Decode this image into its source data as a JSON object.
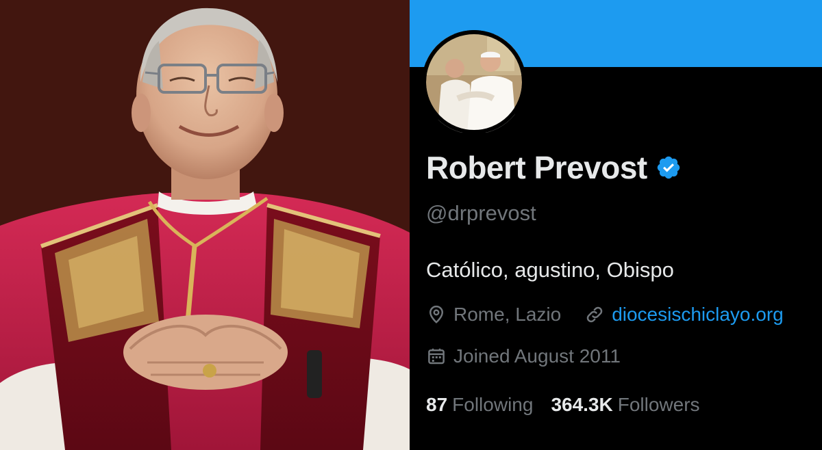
{
  "profile": {
    "name": "Robert Prevost",
    "handle": "@drprevost",
    "bio": "Católico, agustino, Obispo",
    "location": "Rome, Lazio",
    "website": "diocesischiclayo.org",
    "joined": "Joined August 2011",
    "following_count": "87",
    "following_label": "Following",
    "followers_count": "364.3K",
    "followers_label": "Followers"
  },
  "icons": {
    "verified": "verified-badge-icon",
    "location": "location-pin-icon",
    "link": "link-icon",
    "calendar": "calendar-icon"
  },
  "colors": {
    "banner": "#1d9bf0",
    "background": "#000000",
    "primary_text": "#e7e9ea",
    "secondary_text": "#71767b",
    "accent": "#1d9bf0"
  }
}
